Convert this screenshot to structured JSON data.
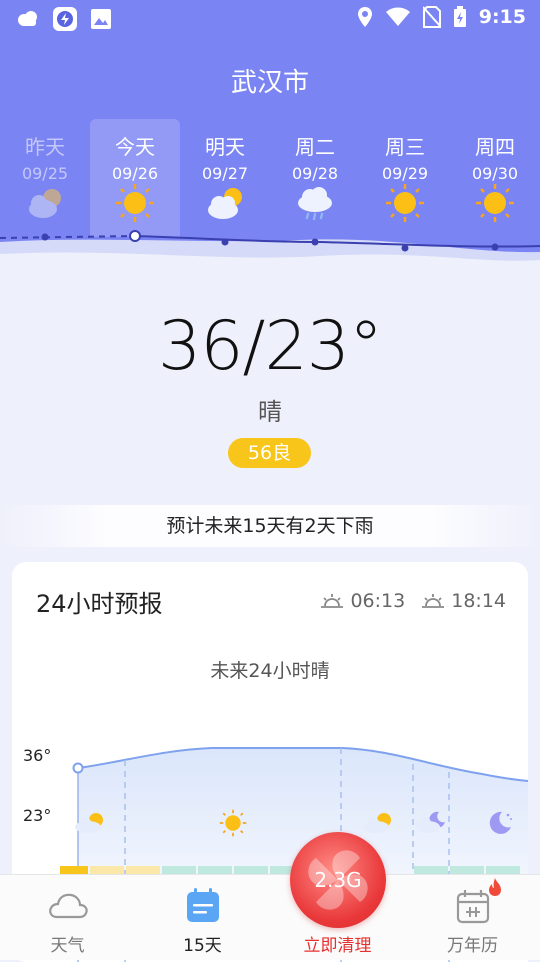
{
  "status_bar": {
    "time": "9:15"
  },
  "header": {
    "city": "武汉市"
  },
  "days": [
    {
      "name": "昨天",
      "date": "09/25",
      "icon": "partly-cloudy-icon"
    },
    {
      "name": "今天",
      "date": "09/26",
      "icon": "sunny-icon"
    },
    {
      "name": "明天",
      "date": "09/27",
      "icon": "partly-cloudy-icon"
    },
    {
      "name": "周二",
      "date": "09/28",
      "icon": "rain-icon"
    },
    {
      "name": "周三",
      "date": "09/29",
      "icon": "sunny-icon"
    },
    {
      "name": "周四",
      "date": "09/30",
      "icon": "sunny-icon"
    }
  ],
  "current": {
    "temp_range": "36/23°",
    "condition": "晴",
    "aqi": "56良"
  },
  "banner": {
    "rain_note": "预计未来15天有2天下雨"
  },
  "hourly": {
    "title": "24小时预报",
    "sunrise": "06:13",
    "sunset": "18:14",
    "note": "未来24小时晴",
    "high_label": "36°",
    "low_label": "23°"
  },
  "aqi_strip_label": "良",
  "bottom_nav": {
    "weather": "天气",
    "fifteen_day": "15天",
    "clean": "立即清理",
    "clean_size": "2.3G",
    "calendar": "万年历"
  },
  "colors": {
    "hero": "#7b84f3",
    "aqi_badge": "#f8c51a",
    "clean_red": "#e7312e",
    "curve": "#7fa2ee"
  }
}
